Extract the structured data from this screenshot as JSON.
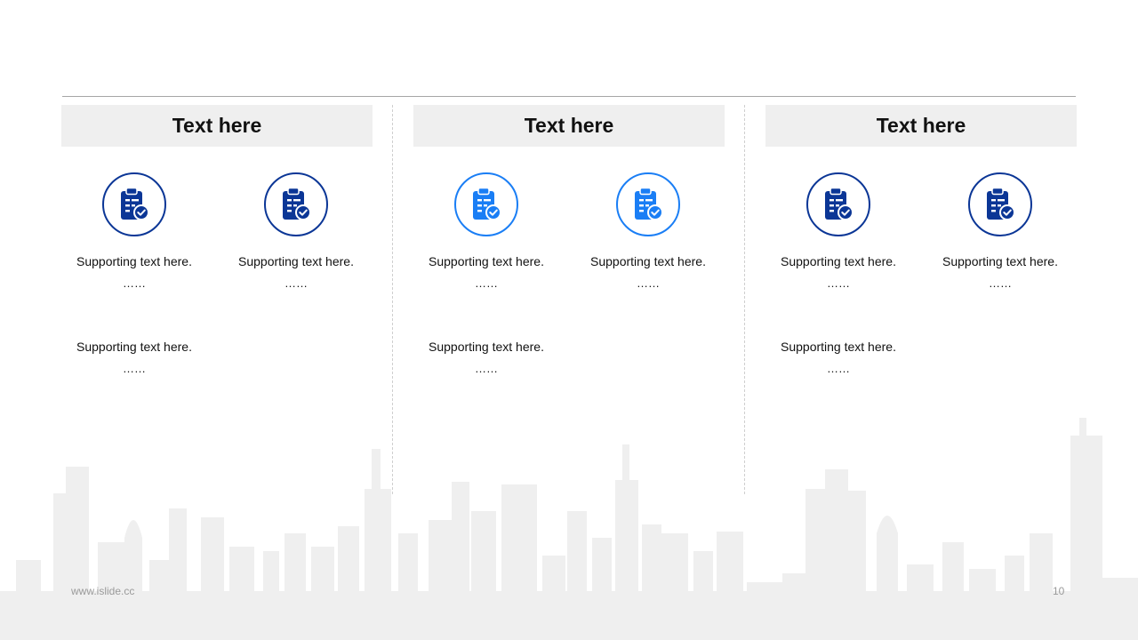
{
  "colors": {
    "dark_blue": "#0b3696",
    "light_blue": "#1a7ef5",
    "header_bg": "#efefef"
  },
  "columns": [
    {
      "header": "Text here",
      "icon_color": "dark-blue",
      "items": [
        {
          "icon": "clipboard-check-icon",
          "text": "Supporting text here.",
          "dots": "……"
        },
        {
          "icon": "clipboard-check-icon",
          "text": "Supporting text here.",
          "dots": "……"
        }
      ],
      "extra": {
        "text": "Supporting text here.",
        "dots": "……"
      }
    },
    {
      "header": "Text here",
      "icon_color": "light-blue",
      "items": [
        {
          "icon": "clipboard-check-icon",
          "text": "Supporting text here.",
          "dots": "……"
        },
        {
          "icon": "clipboard-check-icon",
          "text": "Supporting text here.",
          "dots": "……"
        }
      ],
      "extra": {
        "text": "Supporting text here.",
        "dots": "……"
      }
    },
    {
      "header": "Text here",
      "icon_color": "dark-blue",
      "items": [
        {
          "icon": "clipboard-check-icon",
          "text": "Supporting text here.",
          "dots": "……"
        },
        {
          "icon": "clipboard-check-icon",
          "text": "Supporting text here.",
          "dots": "……"
        }
      ],
      "extra": {
        "text": "Supporting text here.",
        "dots": "……"
      }
    }
  ],
  "footer": {
    "url": "www.islide.cc",
    "page_number": "10"
  }
}
